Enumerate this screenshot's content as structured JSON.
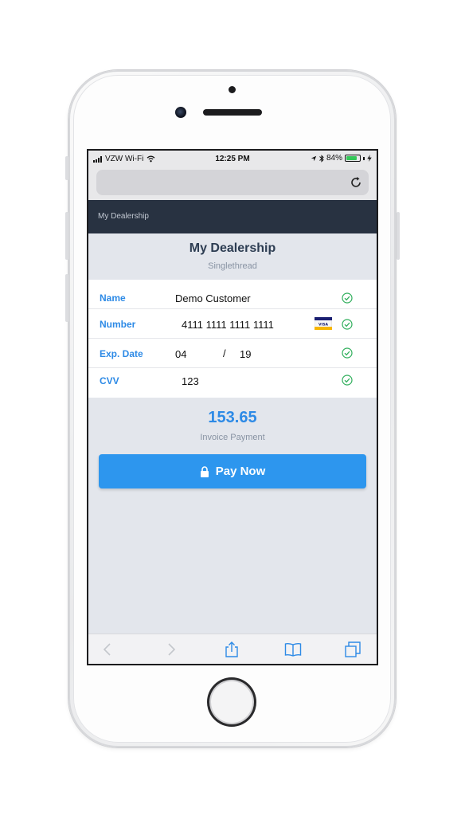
{
  "status_bar": {
    "carrier": "VZW Wi-Fi",
    "time": "12:25 PM",
    "battery_percent": "84%",
    "battery_level": 0.84,
    "icons": [
      "signal-icon",
      "wifi-icon",
      "location-arrow-icon",
      "bluetooth-icon",
      "battery-icon",
      "charging-icon"
    ]
  },
  "browser": {
    "url_text": "",
    "reload_icon": "reload-icon"
  },
  "app_nav": {
    "title": "My Dealership"
  },
  "header": {
    "title": "My Dealership",
    "subtitle": "Singlethread"
  },
  "form": {
    "fields": [
      {
        "label": "Name",
        "value": "Demo Customer",
        "valid": true
      },
      {
        "label": "Number",
        "value": "4111 1111 1111 1111",
        "card_brand": "VISA",
        "valid": true
      },
      {
        "label": "Exp. Date",
        "month": "04",
        "separator": "/",
        "year": "19",
        "valid": true
      },
      {
        "label": "CVV",
        "value": "123",
        "valid": true
      }
    ]
  },
  "payment": {
    "amount": "153.65",
    "label": "Invoice Payment"
  },
  "pay_button": {
    "label": "Pay Now",
    "icon": "lock-icon"
  },
  "toolbar": {
    "icons": [
      "back-icon",
      "forward-icon",
      "share-icon",
      "bookmarks-icon",
      "tabs-icon"
    ]
  },
  "colors": {
    "accent": "#2d8ae6",
    "button": "#2d96ee",
    "nav_bg": "#283241",
    "check": "#2fae5b"
  }
}
